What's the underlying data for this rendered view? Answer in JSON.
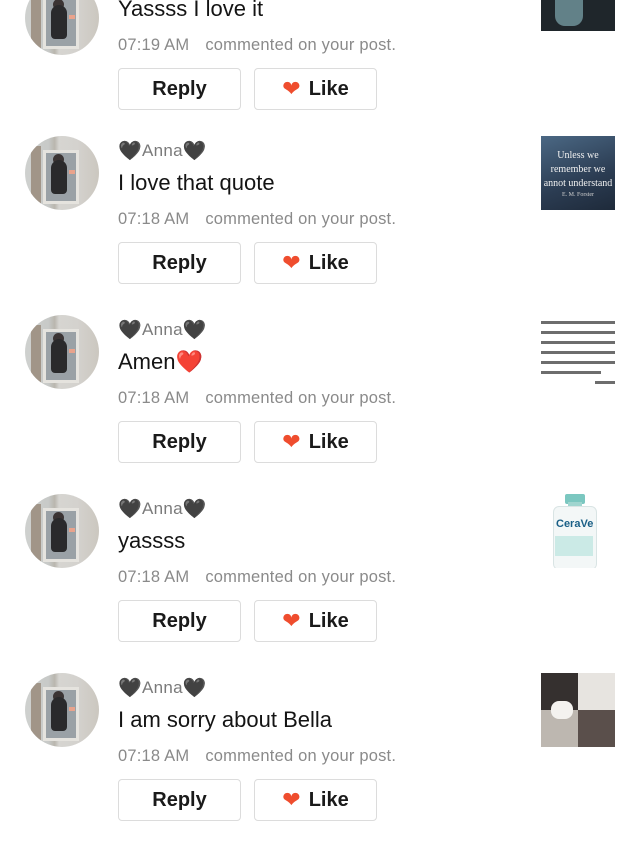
{
  "comments": [
    {
      "username": "",
      "text": "Yassss I love it",
      "time": "07:19 AM",
      "action": "commented on your post.",
      "reply_label": "Reply",
      "like_label": "Like"
    },
    {
      "username": "Anna",
      "text": "I love that quote",
      "time": "07:18 AM",
      "action": "commented on your post.",
      "reply_label": "Reply",
      "like_label": "Like",
      "thumb_text": [
        "Unless we",
        "remember we",
        "annot understand",
        "E. M. Forster"
      ]
    },
    {
      "username": "Anna",
      "text": "Amen",
      "time": "07:18 AM",
      "action": "commented on your post.",
      "reply_label": "Reply",
      "like_label": "Like"
    },
    {
      "username": "Anna",
      "text": "yassss",
      "time": "07:18 AM",
      "action": "commented on your post.",
      "reply_label": "Reply",
      "like_label": "Like",
      "thumb_text": [
        "CeraVe"
      ]
    },
    {
      "username": "Anna",
      "text": "I am sorry about Bella",
      "time": "07:18 AM",
      "action": "commented on your post.",
      "reply_label": "Reply",
      "like_label": "Like"
    }
  ],
  "icons": {
    "black_heart": "black-heart-icon",
    "red_heart": "red-heart-icon",
    "like": "heart-icon"
  },
  "colors": {
    "like_heart": "#ef4d2e",
    "meta_text": "#8a8a8a",
    "username_text": "#7a7a7a"
  }
}
